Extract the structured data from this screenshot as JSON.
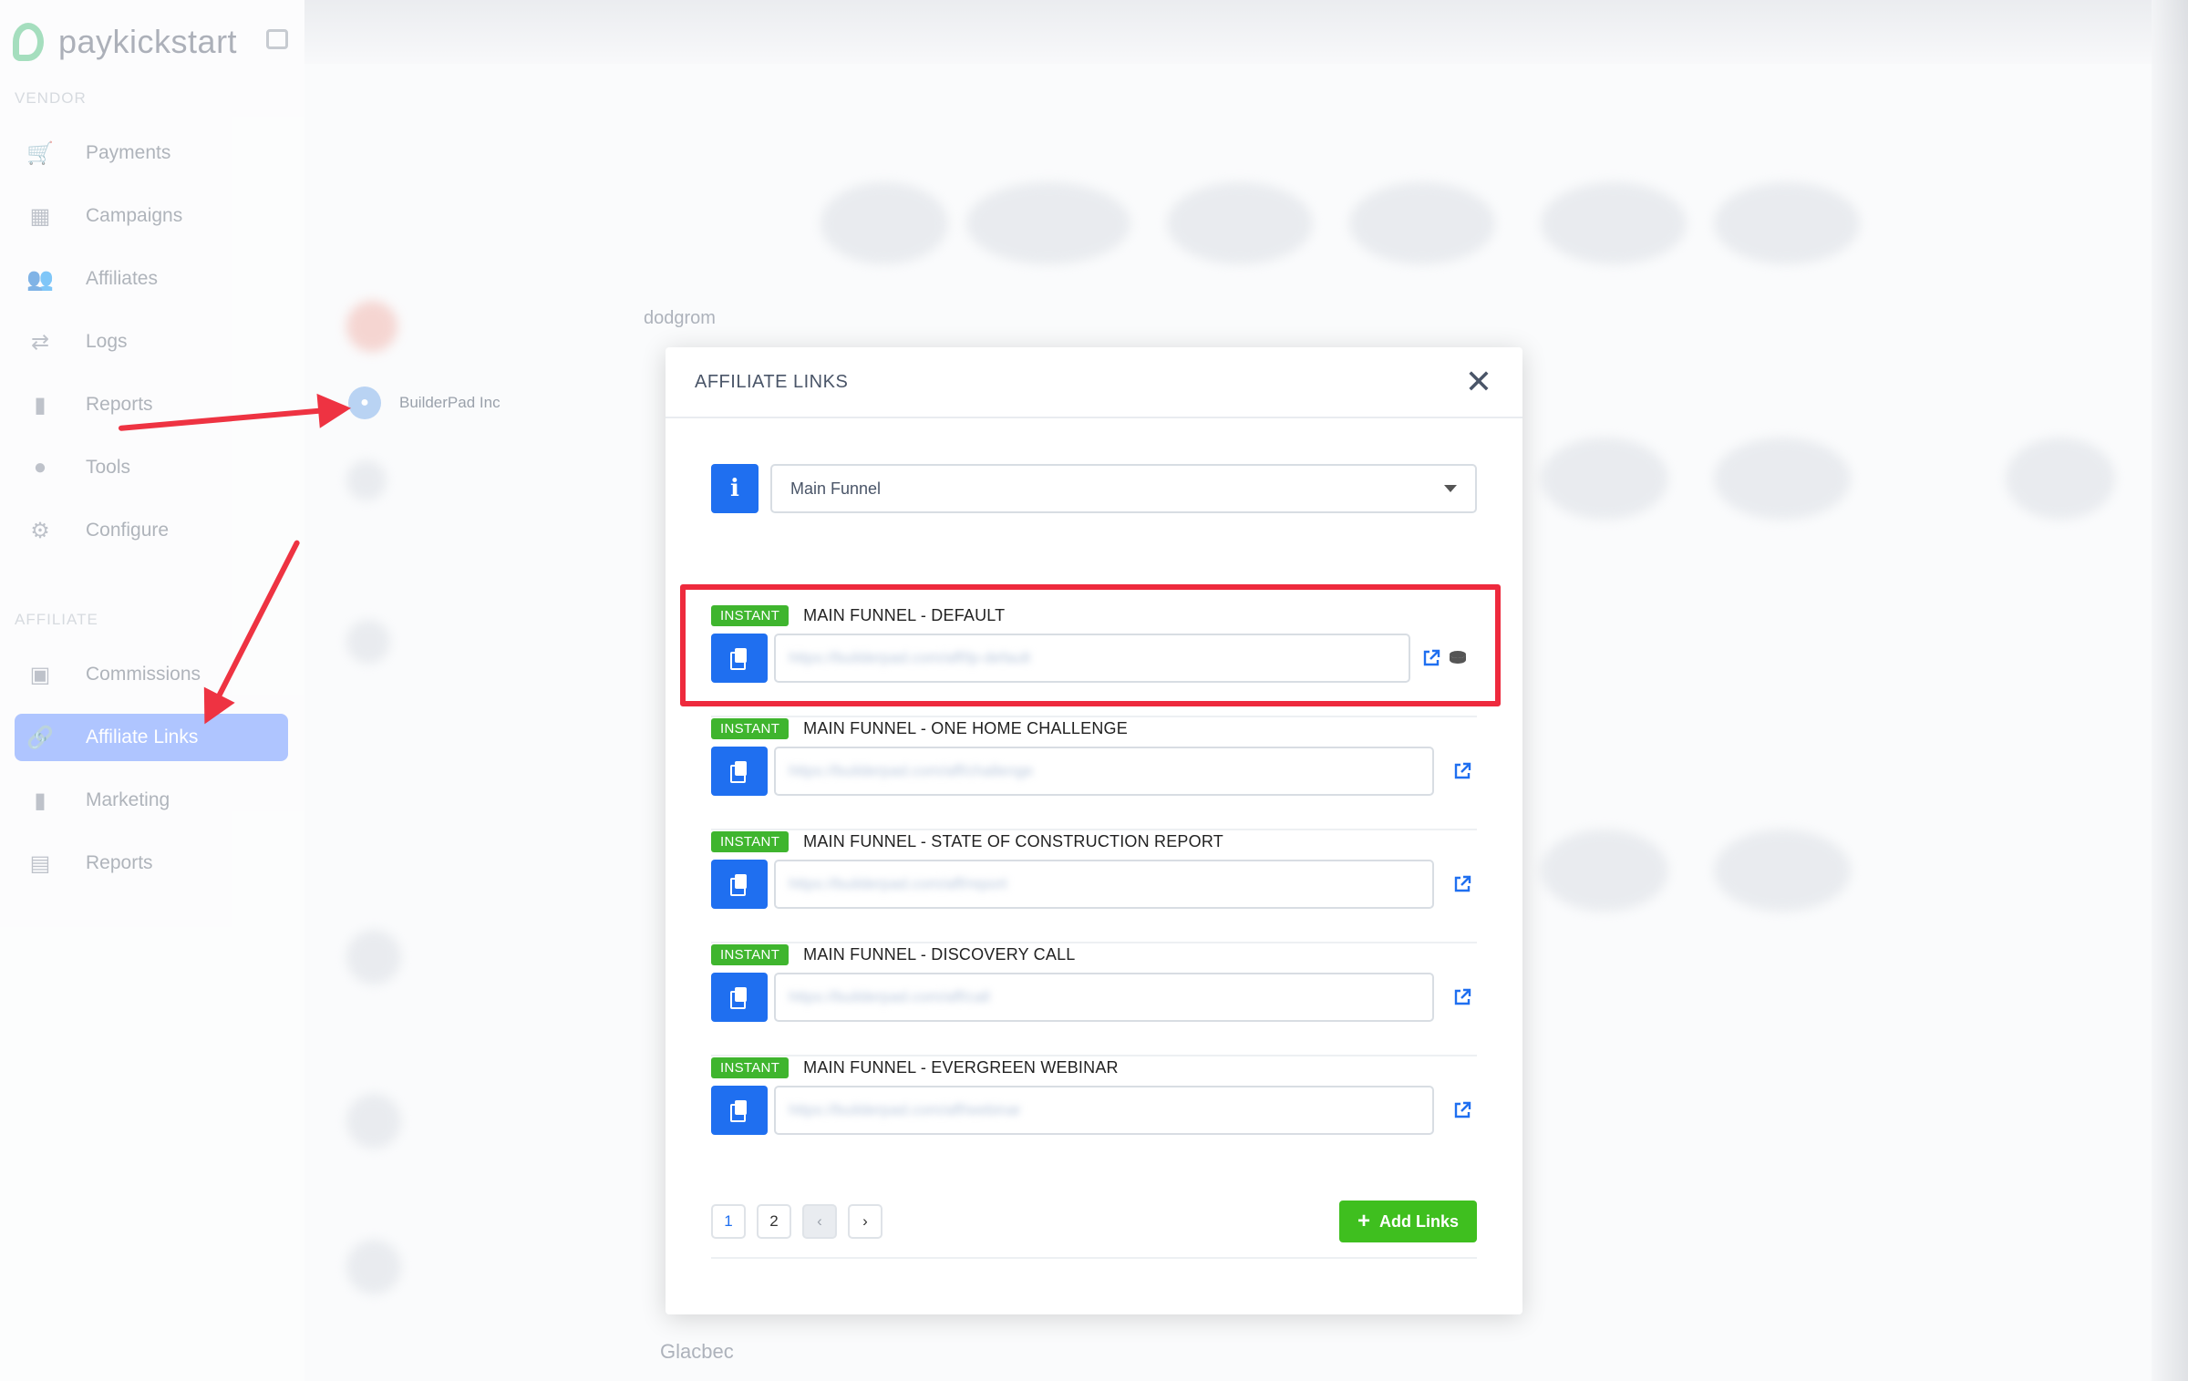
{
  "app": {
    "brand": "paykickstart"
  },
  "sidebar": {
    "vendor_label": "VENDOR",
    "affiliate_label": "AFFILIATE",
    "vendor_items": [
      {
        "label": "Payments",
        "icon": "cart-icon"
      },
      {
        "label": "Campaigns",
        "icon": "campaigns-icon"
      },
      {
        "label": "Affiliates",
        "icon": "users-icon"
      },
      {
        "label": "Logs",
        "icon": "arrows-icon"
      },
      {
        "label": "Reports",
        "icon": "bar-chart-icon"
      },
      {
        "label": "Tools",
        "icon": "lightbulb-icon"
      },
      {
        "label": "Configure",
        "icon": "gear-icon"
      }
    ],
    "affiliate_items": [
      {
        "label": "Commissions",
        "icon": "money-icon"
      },
      {
        "label": "Affiliate Links",
        "icon": "link-icon",
        "active": true
      },
      {
        "label": "Marketing",
        "icon": "bar-chart-icon"
      },
      {
        "label": "Reports",
        "icon": "document-icon"
      }
    ]
  },
  "background": {
    "company_name": "BuilderPad Inc",
    "blurred_text_top": "dodgrom",
    "blurred_text_bottom": "Glacbec"
  },
  "modal": {
    "title": "AFFILIATE LINKS",
    "funnel_select": {
      "value": "Main Funnel"
    },
    "links": [
      {
        "badge": "INSTANT",
        "title": "MAIN FUNNEL - DEFAULT",
        "url": "https://builderpad.com/aff/lp-default",
        "highlighted": true,
        "has_db_icon": true
      },
      {
        "badge": "INSTANT",
        "title": "MAIN FUNNEL - ONE HOME CHALLENGE",
        "url": "https://builderpad.com/aff/challenge",
        "highlighted": false,
        "has_db_icon": false
      },
      {
        "badge": "INSTANT",
        "title": "MAIN FUNNEL - STATE OF CONSTRUCTION REPORT",
        "url": "https://builderpad.com/aff/report",
        "highlighted": false,
        "has_db_icon": false
      },
      {
        "badge": "INSTANT",
        "title": "MAIN FUNNEL - DISCOVERY CALL",
        "url": "https://builderpad.com/aff/call",
        "highlighted": false,
        "has_db_icon": false
      },
      {
        "badge": "INSTANT",
        "title": "MAIN FUNNEL - EVERGREEN WEBINAR",
        "url": "https://builderpad.com/aff/webinar",
        "highlighted": false,
        "has_db_icon": false
      }
    ],
    "pagination": {
      "pages": [
        "1",
        "2"
      ],
      "current": "1",
      "prev": "‹",
      "next": "›"
    },
    "add_links_label": "Add Links"
  },
  "colors": {
    "accent_blue": "#1f6ff0",
    "badge_green": "#3fb52e",
    "add_green": "#3fbf1f",
    "highlight_red": "#ee2a3d",
    "sidebar_active": "#6f96ff"
  }
}
